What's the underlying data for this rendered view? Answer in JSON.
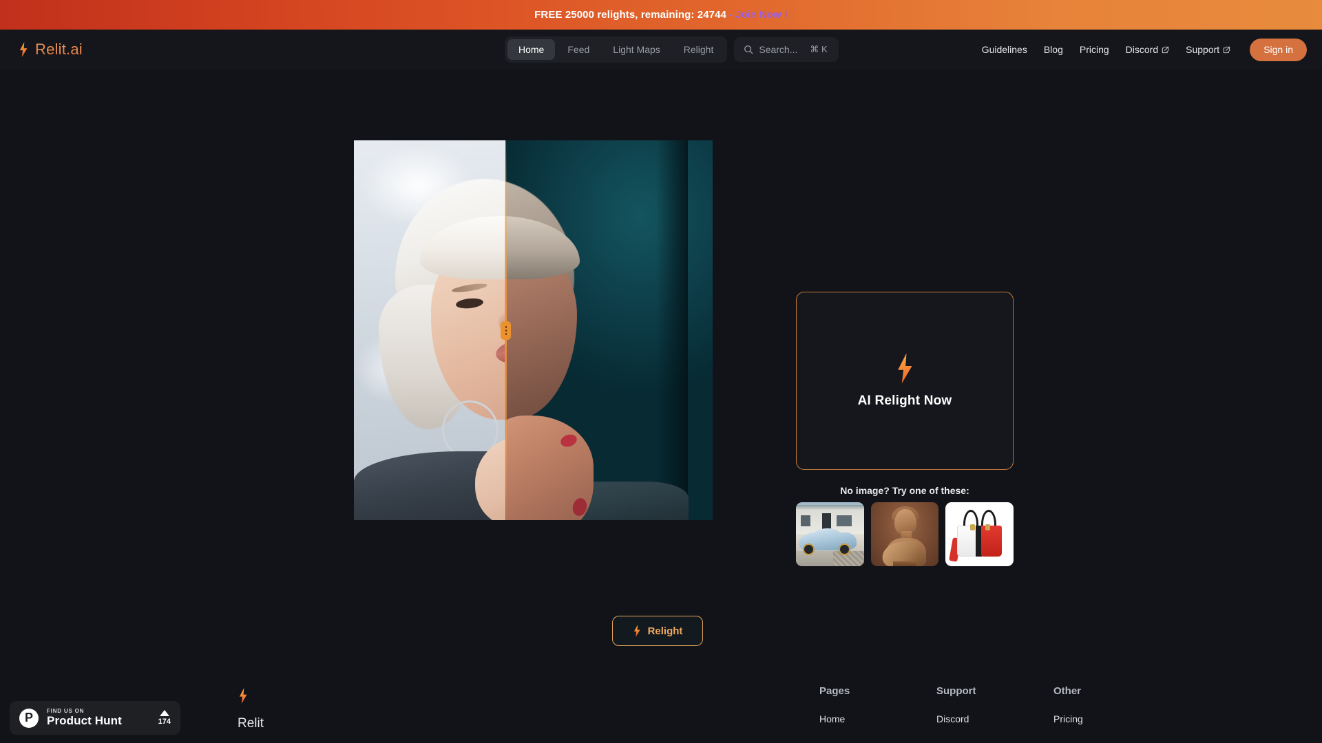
{
  "promo": {
    "text": "FREE 25000 relights, remaining: 24744",
    "separator": "-",
    "cta": "Join Now !"
  },
  "nav": {
    "brand": "Relit.ai",
    "center_items": [
      {
        "label": "Home",
        "active": true
      },
      {
        "label": "Feed",
        "active": false
      },
      {
        "label": "Light Maps",
        "active": false
      },
      {
        "label": "Relight",
        "active": false
      }
    ],
    "search": {
      "placeholder": "Search...",
      "shortcut": "⌘ K"
    },
    "right_items": [
      {
        "label": "Guidelines",
        "external": false
      },
      {
        "label": "Blog",
        "external": false
      },
      {
        "label": "Pricing",
        "external": false
      },
      {
        "label": "Discord",
        "external": true
      },
      {
        "label": "Support",
        "external": true
      }
    ],
    "signin_label": "Sign in"
  },
  "hero": {
    "compare_slider_percent": 42,
    "relight_button_label": "Relight"
  },
  "upload": {
    "title": "AI Relight Now",
    "try_label": "No image? Try one of these:",
    "samples": [
      {
        "name": "blue-supercar"
      },
      {
        "name": "classical-bust"
      },
      {
        "name": "red-white-handbag"
      }
    ]
  },
  "footer": {
    "brand": "Relit",
    "columns": [
      {
        "title": "Pages",
        "links": [
          "Home"
        ]
      },
      {
        "title": "Support",
        "links": [
          "Discord"
        ]
      },
      {
        "title": "Other",
        "links": [
          "Pricing"
        ]
      }
    ]
  },
  "product_hunt": {
    "eyebrow": "FIND US ON",
    "name": "Product Hunt",
    "logo_letter": "P",
    "upvotes": "174"
  },
  "colors": {
    "background": "#111318",
    "surface": "#14161b",
    "accent_orange": "#e8763c",
    "accent_orange_soft": "#f0a95e",
    "promo_cta": "#9b5fe0",
    "signin_bg": "#d4713e"
  }
}
